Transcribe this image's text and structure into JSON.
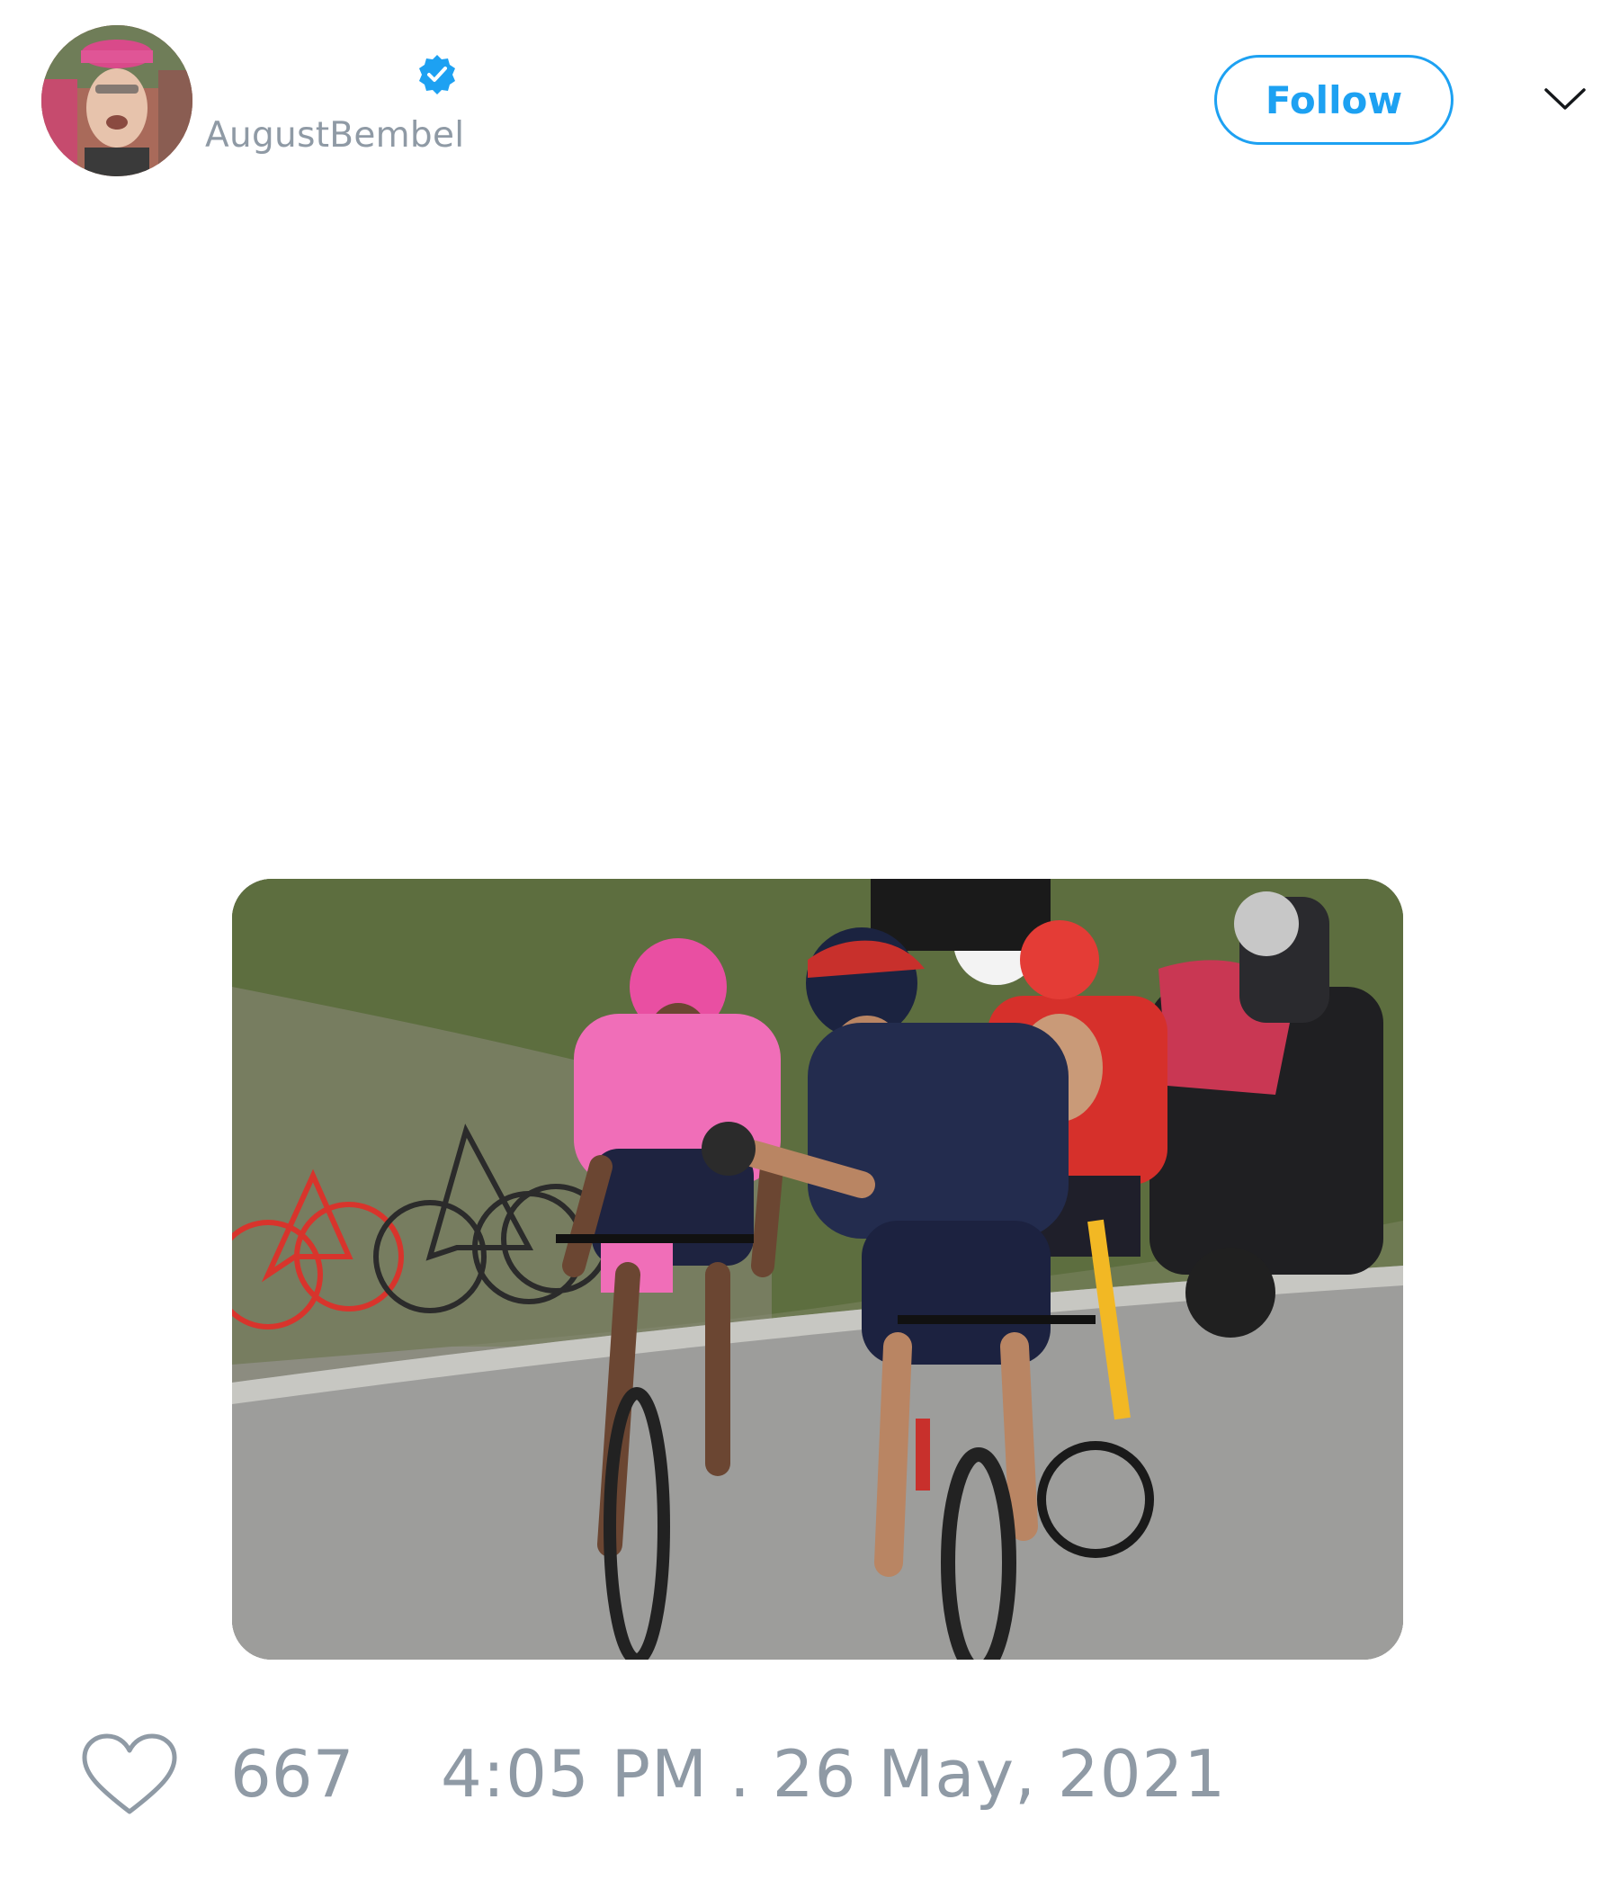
{
  "author": {
    "display_name": "",
    "handle": "AugustBembel",
    "verified": true,
    "avatar_icon": "user-avatar-photo"
  },
  "actions": {
    "follow_label": "Follow",
    "more_icon": "chevron-down-icon"
  },
  "media": {
    "photo_description_icon": "tweet-photo"
  },
  "footer": {
    "like_icon": "heart-icon",
    "like_count": "667",
    "timestamp": "4:05 PM . 26 May, 2021"
  },
  "colors": {
    "accent": "#1da1f2",
    "muted_text": "#8f9aa5",
    "background": "#ffffff"
  }
}
